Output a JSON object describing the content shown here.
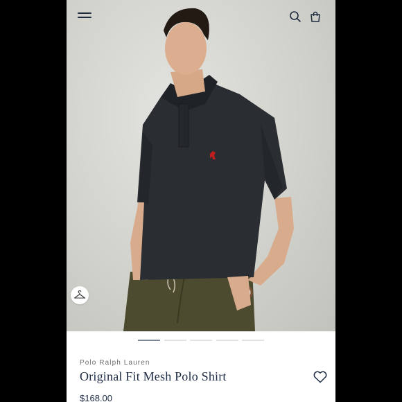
{
  "header": {
    "menu_icon": "hamburger-menu-icon",
    "search_icon": "search-icon",
    "bag_icon": "shopping-bag-icon"
  },
  "gallery": {
    "image_alt": "Model wearing black polo shirt with red pony logo",
    "shirt_color": "#2a2d31",
    "logo_color": "#c0201d",
    "pants_color": "#4c4a2f",
    "hanger_icon": "hanger-icon",
    "total_slides": 5,
    "active_slide": 1
  },
  "product": {
    "brand": "Polo Ralph Lauren",
    "title": "Original Fit Mesh Polo Shirt",
    "price": "$168.00",
    "wishlist_icon": "heart-outline-icon"
  },
  "colors": {
    "navy_text": "#1c2a44",
    "active_indicator": "#7e8897",
    "inactive_indicator": "#e2e2e2"
  }
}
